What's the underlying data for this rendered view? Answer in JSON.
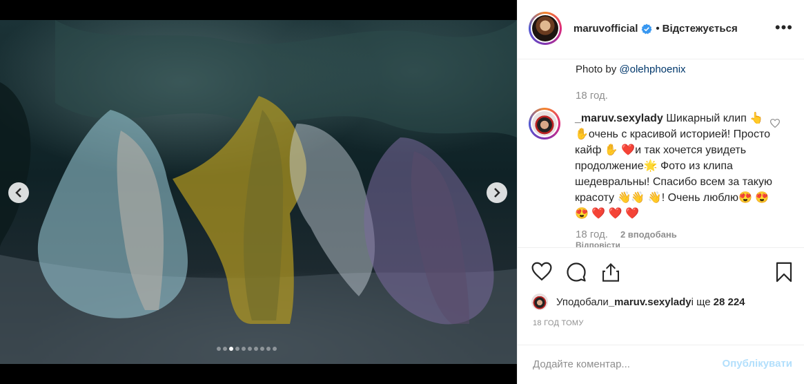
{
  "header": {
    "username": "maruvofficial",
    "separator": "•",
    "follow_status": "Відстежується",
    "more_label": "•••"
  },
  "media": {
    "image_alt": "Фото",
    "carousel_count": 10,
    "carousel_active_index": 2
  },
  "caption": {
    "prefix": "Photo by ",
    "mention": "@olehphoenix",
    "time": "18 год."
  },
  "comment": {
    "username": "_maruv.sexylady",
    "text": "Шикарный клип 👆✋очень с красивой историей! Просто кайф ✋ ❤️и так хочется увидеть продолжение🌟 Фото из клипа шедевральны! Спасибо всем за такую красоту 👋👋 👋! Очень люблю😍 😍 😍 ❤️ ❤️ ❤️",
    "time": "18 год.",
    "likes": "2 вподобань",
    "reply": "Відповісти"
  },
  "likes": {
    "prefix": "Уподобали ",
    "user": "_maruv.sexylady",
    "middle": " і ще ",
    "count": "28 224"
  },
  "post_time": "18 ГОД ТОМУ",
  "add_comment": {
    "placeholder": "Додайте коментар...",
    "publish_label": "Опублікувати"
  },
  "colors": {
    "link": "#00376b",
    "muted": "#8e8e8e",
    "publish_disabled": "#b2dffc",
    "verified": "#3897f0"
  }
}
